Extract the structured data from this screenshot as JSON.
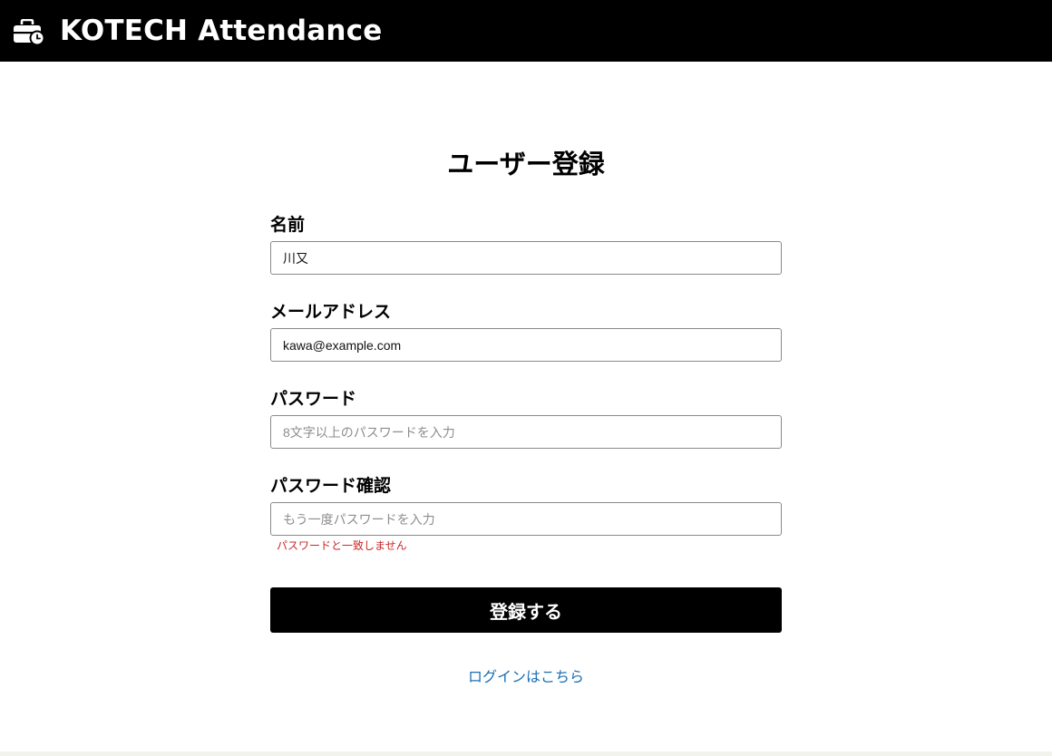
{
  "header": {
    "app_title": "KOTECH Attendance",
    "logo_icon": "briefcase-clock-icon"
  },
  "form": {
    "title": "ユーザー登録",
    "fields": [
      {
        "label": "名前",
        "value": "川又",
        "placeholder": ""
      },
      {
        "label": "メールアドレス",
        "value": "kawa@example.com",
        "placeholder": ""
      },
      {
        "label": "パスワード",
        "value": "",
        "placeholder": "8文字以上のパスワードを入力"
      },
      {
        "label": "パスワード確認",
        "value": "",
        "placeholder": "もう一度パスワードを入力",
        "error": "パスワードと一致しません"
      }
    ],
    "submit_label": "登録する",
    "login_link_label": "ログインはこちら"
  },
  "colors": {
    "header_bg": "#000000",
    "button_bg": "#000000",
    "error": "#c62828",
    "link": "#1a6fb5"
  }
}
